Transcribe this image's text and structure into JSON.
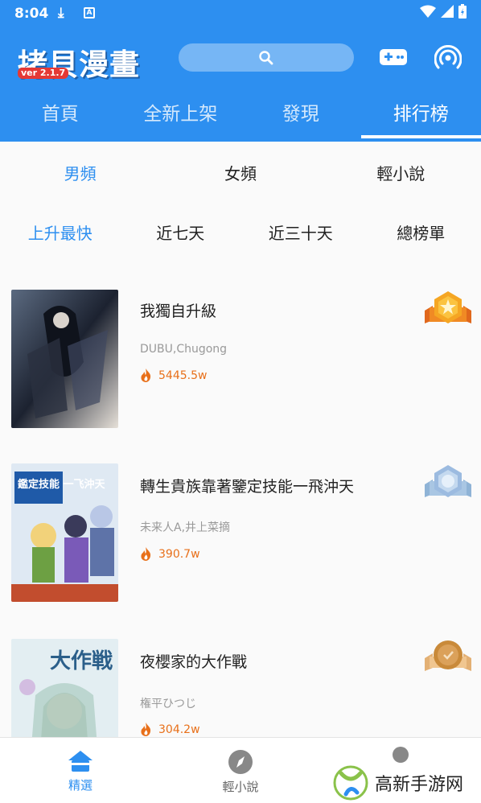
{
  "status": {
    "time": "8:04"
  },
  "app": {
    "name": "拷貝漫畫",
    "version": "ver 2.1.7"
  },
  "tabs": [
    {
      "label": "首頁"
    },
    {
      "label": "全新上架"
    },
    {
      "label": "發現"
    },
    {
      "label": "排行榜",
      "active": true
    }
  ],
  "genres": [
    {
      "label": "男頻",
      "active": true
    },
    {
      "label": "女頻"
    },
    {
      "label": "輕小說"
    }
  ],
  "periods": [
    {
      "label": "上升最快",
      "active": true
    },
    {
      "label": "近七天"
    },
    {
      "label": "近三十天"
    },
    {
      "label": "總榜單"
    }
  ],
  "rankings": [
    {
      "rank": 1,
      "medal": "gold",
      "title": "我獨自升級",
      "author": "DUBU,Chugong",
      "heat": "5445.5w"
    },
    {
      "rank": 2,
      "medal": "silver",
      "title": "轉生貴族靠著鑒定技能一飛沖天",
      "author": "未来人A,井上菜摘",
      "heat": "390.7w"
    },
    {
      "rank": 3,
      "medal": "bronze",
      "title": "夜櫻家的大作戰",
      "author": "権平ひつじ",
      "heat": "304.2w"
    }
  ],
  "covers": [
    {
      "text": ""
    },
    {
      "text": "鑑定技能 一飞沖天"
    },
    {
      "text": "大作戦"
    }
  ],
  "bottom_nav": [
    {
      "label": "精選",
      "active": true,
      "icon": "home-icon"
    },
    {
      "label": "輕小說",
      "icon": "compass-icon"
    },
    {
      "label": "",
      "icon": "profile-icon"
    }
  ],
  "watermark": {
    "text": "高新手游网"
  },
  "colors": {
    "primary": "#2d8ff0",
    "heat": "#e8701a",
    "gold": "#f5a623",
    "silver": "#8fb3d6",
    "bronze": "#c98a3a"
  }
}
